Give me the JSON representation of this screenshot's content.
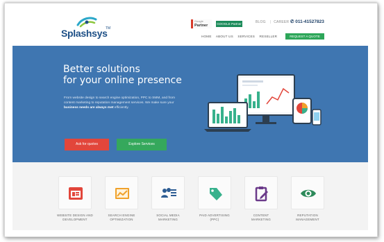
{
  "brand": {
    "name": "Splashsys",
    "tm": "TM"
  },
  "header": {
    "partner_sub": "Google",
    "partner_main": "Partner",
    "google_badge": "GOOGLE Partner",
    "links": [
      "BLOG",
      "CAREER"
    ],
    "phone": "011-41527823"
  },
  "nav": {
    "items": [
      "HOME",
      "ABOUT US",
      "SERVICES",
      "RESELLER"
    ],
    "cta": "REQUEST A QUOTE"
  },
  "hero": {
    "title_line1": "Better solutions",
    "title_line2": "for your online presence",
    "text_plain": "From website design to search engine optimization, PPC to SMM, and from content marketing to reputation management services. We make sure your ",
    "text_bold": "business needs are always met",
    "text_end": " efficiently.",
    "btn_quote": "Ask for quotes",
    "btn_explore": "Explore Services"
  },
  "services": [
    {
      "line1": "WEBSITE DESIGN AND",
      "line2": "DEVELOPMENT",
      "icon": "website-icon",
      "color": "#e2463b"
    },
    {
      "line1": "SEARCH ENGINE",
      "line2": "OPTIMIZATION",
      "icon": "seo-chart-icon",
      "color": "#f0a12a"
    },
    {
      "line1": "SOCIAL MEDIA",
      "line2": "MARKETING",
      "icon": "social-users-icon",
      "color": "#2c5c93"
    },
    {
      "line1": "PAID ADVERTISING",
      "line2": "(PPC)",
      "icon": "tag-icon",
      "color": "#37b18c"
    },
    {
      "line1": "CONTENT",
      "line2": "MARKETING",
      "icon": "clipboard-pen-icon",
      "color": "#6b3a8a"
    },
    {
      "line1": "REPUTATION",
      "line2": "MANAGEMENT",
      "icon": "eye-icon",
      "color": "#2d8a5a"
    }
  ],
  "colors": {
    "hero_bg": "#3f76b1",
    "cta_green": "#2da659",
    "quote_red": "#e2463b",
    "brand_blue": "#1d4f86"
  }
}
